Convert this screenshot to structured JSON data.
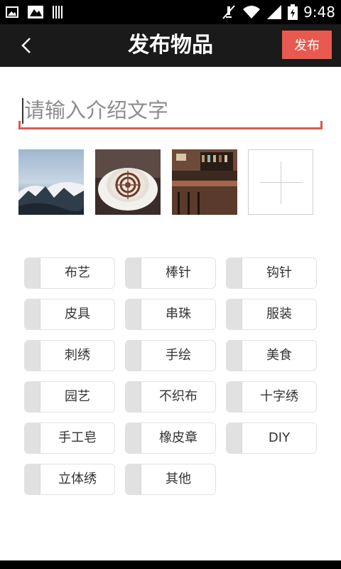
{
  "status_bar": {
    "time": "9:48",
    "left_icons": [
      "image-icon",
      "gallery-icon",
      "barcode-icon"
    ],
    "right_icons": [
      "mute-icon",
      "wifi-icon",
      "signal-icon",
      "battery-charging-icon"
    ]
  },
  "header": {
    "title": "发布物品",
    "back_icon": "chevron-left-icon",
    "publish_label": "发布",
    "accent": "#e85a4f"
  },
  "intro": {
    "placeholder": "请输入介绍文字",
    "value": "",
    "underline_color": "#e0584d"
  },
  "photos": [
    {
      "name": "photo-mountain-clouds"
    },
    {
      "name": "photo-latte-art"
    },
    {
      "name": "photo-cafe-bar"
    }
  ],
  "add_photo_icon": "plus-icon",
  "tags": [
    "布艺",
    "棒针",
    "钩针",
    "皮具",
    "串珠",
    "服装",
    "刺绣",
    "手绘",
    "美食",
    "园艺",
    "不织布",
    "十字绣",
    "手工皂",
    "橡皮章",
    "DIY",
    "立体绣",
    "其他"
  ]
}
